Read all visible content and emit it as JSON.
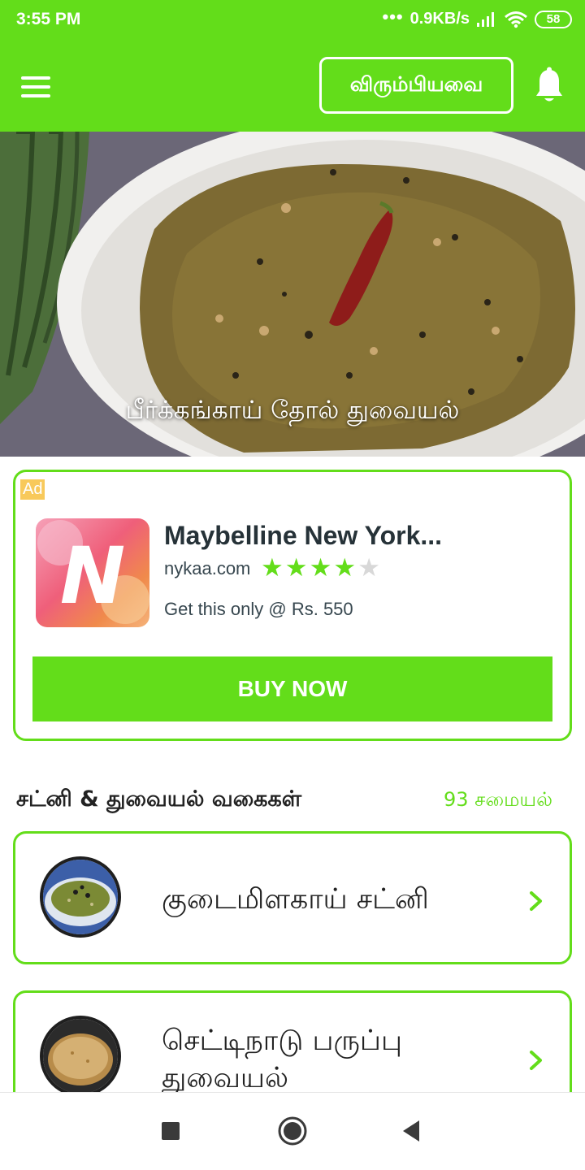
{
  "status": {
    "time": "3:55 PM",
    "network_speed": "0.9KB/s",
    "battery": "58",
    "dots": "•••"
  },
  "appbar": {
    "favorites_label": "விரும்பியவை"
  },
  "hero": {
    "caption": "பீர்க்கங்காய் தோல் துவையல்"
  },
  "ad": {
    "badge": "Ad",
    "title": "Maybelline New York...",
    "domain": "nykaa.com",
    "rating": 4,
    "rating_max": 5,
    "description": "Get this only @ Rs. 550",
    "cta": "BUY NOW",
    "logo_letter": "N"
  },
  "section": {
    "title": "சட்னி & துவையல் வகைகள்",
    "count": "93 சமையல்"
  },
  "recipes": [
    {
      "name": "குடைமிளகாய் சட்னி"
    },
    {
      "name": "செட்டிநாடு பருப்பு துவையல்"
    }
  ],
  "colors": {
    "accent": "#63dd1a",
    "ad_badge": "#f8c95b",
    "title_text": "#263238"
  },
  "icons": {
    "menu": "hamburger-icon",
    "notifications": "bell-icon",
    "row_arrow": "chevron-right-icon",
    "nav_recents": "square-icon",
    "nav_home": "circle-icon",
    "nav_back": "triangle-back-icon"
  }
}
